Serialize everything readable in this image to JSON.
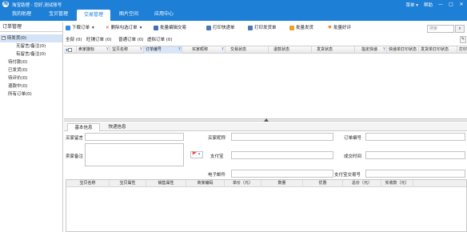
{
  "titlebar": {
    "logo": "淘",
    "title": "淘宝助理 - 您好,测试账号",
    "menu_label": "菜单 ▾",
    "help_label": "帮助",
    "controls": [
      "—",
      "□",
      "✕"
    ]
  },
  "nav": {
    "tabs": [
      {
        "label": "我的助理"
      },
      {
        "label": "宝贝管理"
      },
      {
        "label": "交易管理",
        "active": true
      },
      {
        "label": "图片空间"
      },
      {
        "label": "应用中心"
      }
    ]
  },
  "sidebar": {
    "header": "订单管理",
    "items": [
      {
        "label": "待发货(0)",
        "icon": "minus-box",
        "selected": true
      },
      {
        "label": "无留言/备注(0)"
      },
      {
        "label": "有留言/备注(0)"
      },
      {
        "label": "待付款(0)"
      },
      {
        "label": "已发货(0)"
      },
      {
        "label": "待评价(0)"
      },
      {
        "label": "退款中(0)"
      },
      {
        "label": "所有订单(0)"
      }
    ]
  },
  "toolbar": {
    "buttons": [
      {
        "label": "下载订单",
        "icon": "download-icon",
        "color": "#2f8be0",
        "dropdown": true
      },
      {
        "label": "删除勾选订单",
        "icon": "delete-x-icon",
        "color": "#d93025",
        "dropdown": true
      },
      {
        "label": "批量编辑交易",
        "icon": "edit-list-icon",
        "color": "#3f6fb5"
      },
      {
        "label": "打印快递单",
        "icon": "printer-icon",
        "color": "#4a78b9"
      },
      {
        "label": "打印发货单",
        "icon": "printer-icon",
        "color": "#4a78b9"
      },
      {
        "label": "批量发货",
        "icon": "ship-icon",
        "color": "#f0a020"
      },
      {
        "label": "批量好评",
        "icon": "heart-icon",
        "color": "#f07a20"
      }
    ],
    "search_placeholder": "搜索",
    "search_icon": "magnifier-icon"
  },
  "subtabs": [
    "全部 (0)",
    "旺铺订单 (0)",
    "普通订单 (0)",
    "虚拟订单 (0)"
  ],
  "grid": {
    "columns": [
      {
        "label": "卖家旗标"
      },
      {
        "label": "宝贝名称"
      },
      {
        "label": "订单编号"
      },
      {
        "label": "买家昵称"
      },
      {
        "label": "交易状态"
      },
      {
        "label": "退款状态"
      },
      {
        "label": "发货状态"
      },
      {
        "label": "指定快递"
      },
      {
        "label": "快递单打印状态"
      },
      {
        "label": "发货单打印状态"
      },
      {
        "label": "打印"
      }
    ]
  },
  "detail": {
    "tabs": [
      {
        "label": "基本信息",
        "active": true
      },
      {
        "label": "快递信息"
      }
    ],
    "fields": {
      "buyer_message": "买家留言",
      "buyer_nick": "买家昵称",
      "order_no": "订单编号",
      "seller_memo": "卖家备注",
      "flag": "🚩",
      "alipay": "支付宝",
      "deal_time": "成交时间",
      "email": "电子邮件",
      "alipay_trade_no": "支付宝交易号"
    },
    "items_columns": [
      "宝贝名称",
      "宝贝属性",
      "销售属性",
      "商家编码",
      "单价（元）",
      "数量",
      "优惠",
      "总价（元）",
      "实收款（元）"
    ]
  },
  "colors": {
    "brand": "#1e7fd6",
    "selection": "#d4e3f6"
  }
}
